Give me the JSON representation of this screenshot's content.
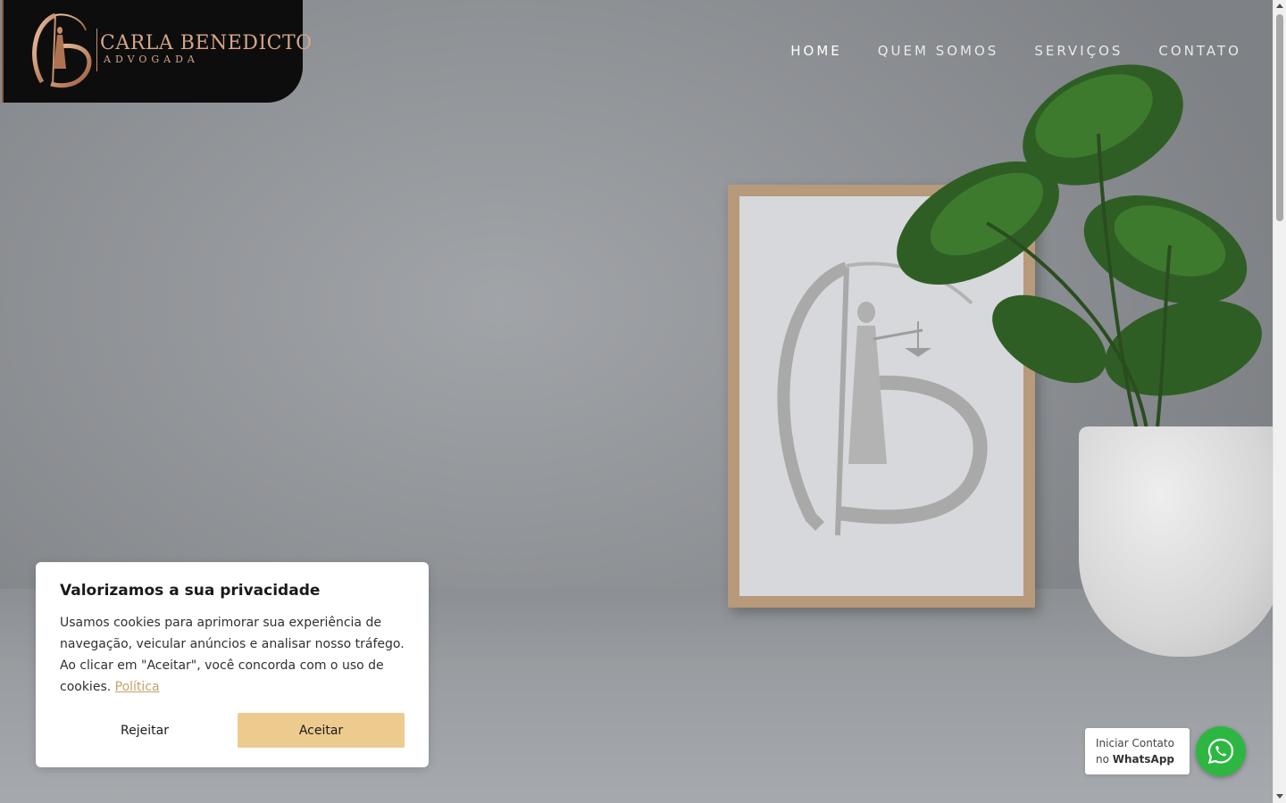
{
  "brand": {
    "name": "CARLA BENEDICTO",
    "subtitle": "ADVOGADA",
    "logo_icon": "cb-justice-monogram"
  },
  "nav": {
    "items": [
      {
        "label": "HOME",
        "active": true
      },
      {
        "label": "QUEM SOMOS",
        "active": false
      },
      {
        "label": "SERVIÇOS",
        "active": false
      },
      {
        "label": "CONTATO",
        "active": false
      }
    ]
  },
  "hero": {
    "image": "framed-cb-monogram-with-monstera-plant"
  },
  "cookie_banner": {
    "title": "Valorizamos a sua privacidade",
    "text": "Usamos cookies para aprimorar sua experiência de navegação, veicular anúncios e analisar nosso tráfego. Ao clicar em \"Aceitar\", você concorda com o uso de cookies.",
    "policy_link": "Política",
    "reject_label": "Rejeitar",
    "accept_label": "Aceitar"
  },
  "whatsapp": {
    "line1": "Iniciar Contato",
    "prefix": "no",
    "app": "WhatsApp",
    "icon": "whatsapp-icon"
  },
  "colors": {
    "accent_gold": "#edca8e",
    "logo_copper": "#d4a587",
    "whatsapp_green": "#2db742"
  }
}
